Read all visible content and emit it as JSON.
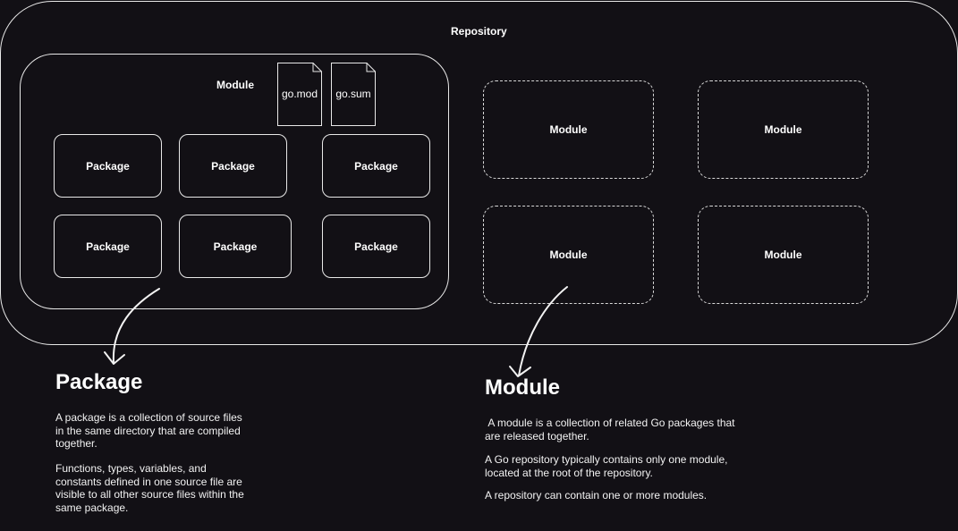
{
  "repository_label": "Repository",
  "main_module": {
    "label": "Module",
    "files": [
      "go.mod",
      "go.sum"
    ],
    "packages": [
      "Package",
      "Package",
      "Package",
      "Package",
      "Package",
      "Package"
    ]
  },
  "other_modules": [
    "Module",
    "Module",
    "Module",
    "Module"
  ],
  "package_section": {
    "heading": "Package",
    "paragraphs": [
      "A package is a collection of source files in the same directory that are compiled together.",
      "Functions, types, variables, and constants defined in one source file are visible to all other source files within the same package."
    ]
  },
  "module_section": {
    "heading": "Module",
    "paragraphs": [
      " A module is a collection of related Go packages that are released together.",
      "A Go repository typically contains only one module, located at the root of the repository.",
      "A repository can contain one or more modules."
    ]
  },
  "colors": {
    "background": "#121015",
    "stroke": "#e8e8e8",
    "text": "#ffffff"
  }
}
